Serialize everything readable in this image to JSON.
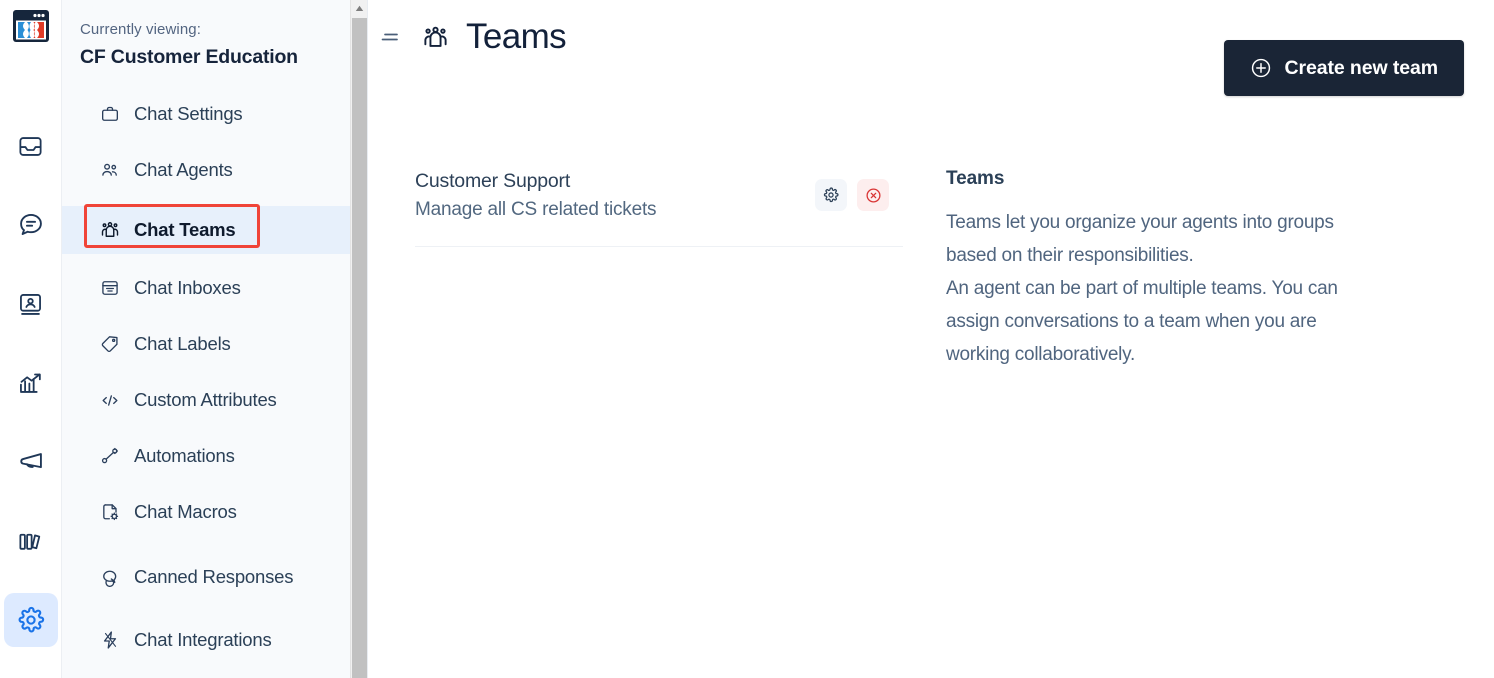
{
  "colors": {
    "accent_blue": "#1a73e8",
    "dark_button": "#1a2536",
    "highlight_red": "#f04438",
    "active_sidebar_bg": "#e7f0fb",
    "sidebar_bg": "#f8fafc",
    "delete_red": "#d93434"
  },
  "rail": {
    "logo_name": "app-logo",
    "items": [
      {
        "icon": "inbox-icon",
        "name": "rail-inbox",
        "active": false
      },
      {
        "icon": "chat-bubble-icon",
        "name": "rail-conversations",
        "active": false
      },
      {
        "icon": "contacts-icon",
        "name": "rail-contacts",
        "active": false
      },
      {
        "icon": "reports-chart-icon",
        "name": "rail-reports",
        "active": false
      },
      {
        "icon": "campaigns-megaphone-icon",
        "name": "rail-campaigns",
        "active": false
      },
      {
        "icon": "library-books-icon",
        "name": "rail-library",
        "active": false
      },
      {
        "icon": "gear-icon",
        "name": "rail-settings",
        "active": true
      }
    ]
  },
  "sidebar": {
    "viewing_label": "Currently viewing:",
    "account_name": "CF Customer Education",
    "items": [
      {
        "label": "Chat Settings",
        "icon": "briefcase-icon",
        "active": false
      },
      {
        "label": "Chat Agents",
        "icon": "agents-people-icon",
        "active": false
      },
      {
        "label": "Chat Teams",
        "icon": "teams-group-icon",
        "active": true
      },
      {
        "label": "Chat Inboxes",
        "icon": "inbox-tray-icon",
        "active": false
      },
      {
        "label": "Chat Labels",
        "icon": "tag-icon",
        "active": false
      },
      {
        "label": "Custom Attributes",
        "icon": "code-brackets-icon",
        "active": false
      },
      {
        "label": "Automations",
        "icon": "automation-node-icon",
        "active": false
      },
      {
        "label": "Chat Macros",
        "icon": "macro-gear-icon",
        "active": false
      },
      {
        "label": "Canned Responses",
        "icon": "canned-chat-icon",
        "active": false
      },
      {
        "label": "Chat Integrations",
        "icon": "lightning-bolt-icon",
        "active": false
      }
    ],
    "scrollbar": {
      "arrow": "▲"
    }
  },
  "header": {
    "menu_icon": "hamburger-icon",
    "title_icon": "teams-group-icon",
    "title": "Teams",
    "create_button": {
      "label": "Create new team",
      "icon": "plus-circle-icon"
    }
  },
  "teams": {
    "list": [
      {
        "name": "Customer Support",
        "description": "Manage all CS related tickets",
        "settings_icon": "gear-icon",
        "delete_icon": "delete-circle-icon"
      }
    ]
  },
  "info_panel": {
    "title": "Teams",
    "paragraph1": "Teams let you organize your agents into groups based on their responsibilities.",
    "paragraph2": "An agent can be part of multiple teams. You can assign conversations to a team when you are working collaboratively."
  }
}
